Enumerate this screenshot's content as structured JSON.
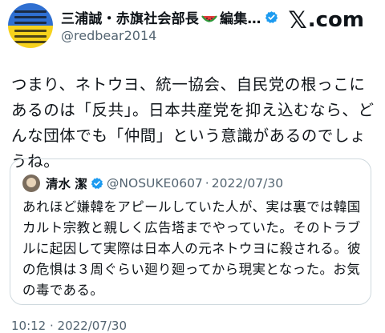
{
  "header": {
    "display_name": "三浦誠・赤旗社会部長",
    "display_name_suffix": "編集…",
    "handle": "@redbear2014",
    "brand": ".com",
    "avatar_icon": "peace-sign-avatar",
    "verified_icon": "verified-badge-icon",
    "emoji_icon": "watermelon-icon"
  },
  "tweet": {
    "text": "つまり、ネトウヨ、統一協会、自民党の根っこにあるのは「反共」。日本共産党を抑え込むなら、どんな団体でも「仲間」という意識があるのでしょうね。"
  },
  "quote": {
    "name": "清水 潔",
    "handle": "@NOSUKE0607",
    "date": "2022/07/30",
    "separator": "·",
    "text": "あれほど嫌韓をアピールしていた人が、実は裏では韓国カルト宗教と親しく広告塔までやっていた。そのトラブルに起因して実際は日本人の元ネトウヨに殺される。彼の危惧は３周ぐらい廻り廻ってから現実となった。お気の毒である。"
  },
  "footer": {
    "timestamp": "10:12 · 2022/07/30"
  },
  "colors": {
    "text": "#0f1419",
    "muted": "#536471",
    "verified": "#1d9bf0",
    "border": "#cfd9de"
  }
}
